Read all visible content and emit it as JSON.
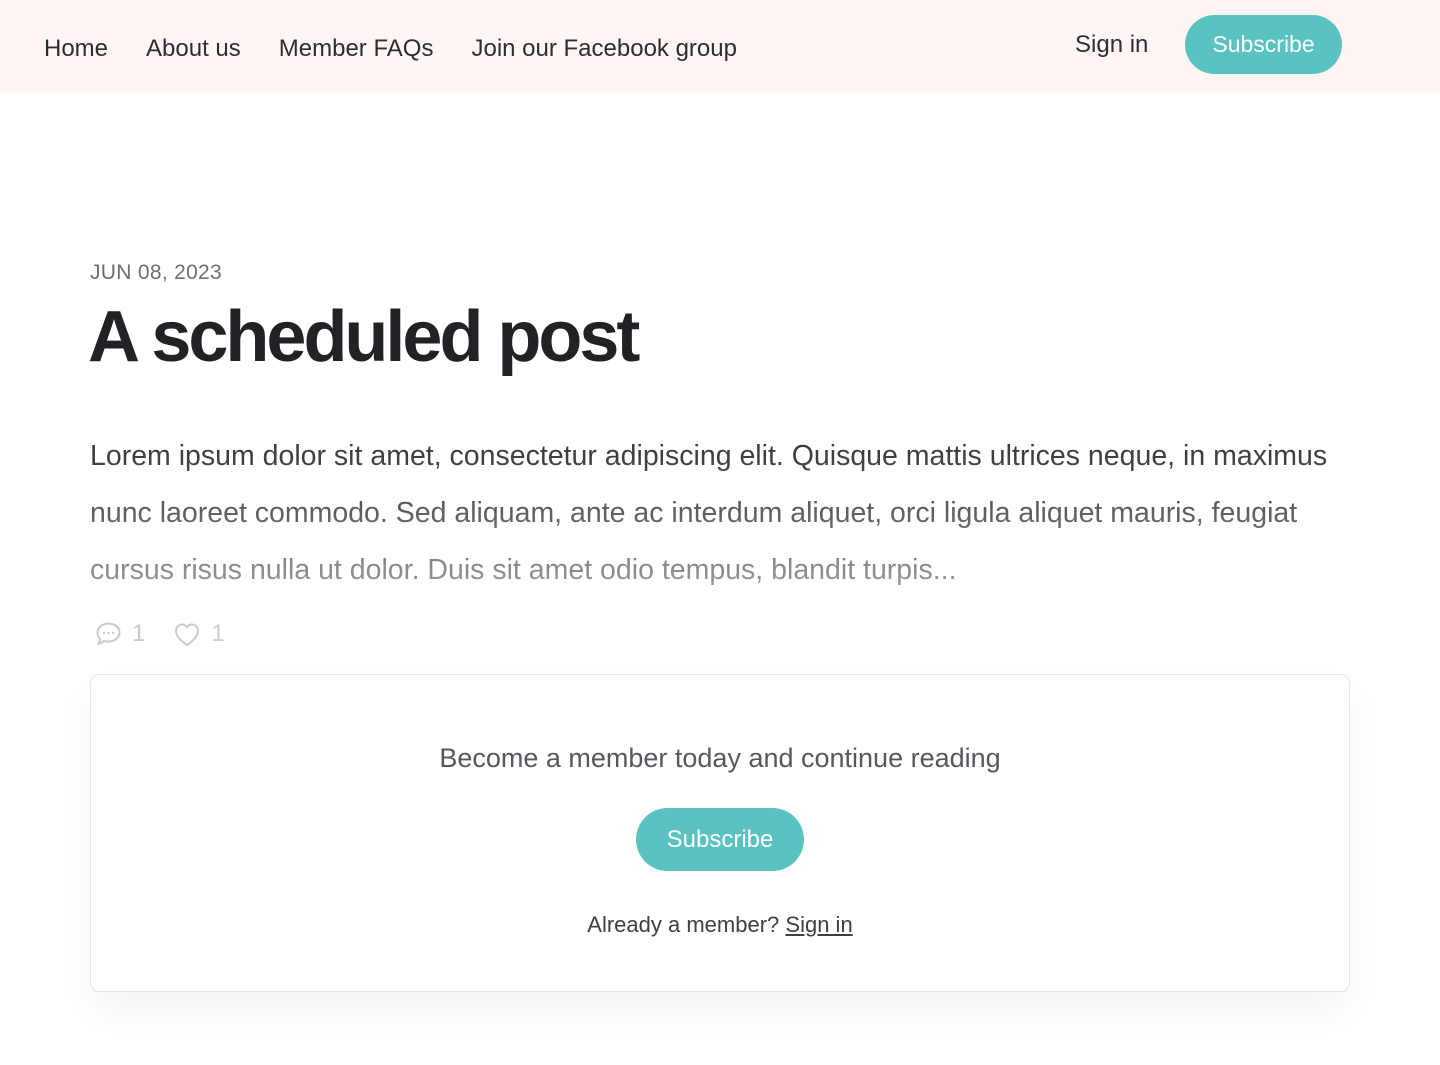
{
  "header": {
    "nav": [
      {
        "label": "Home"
      },
      {
        "label": "About us"
      },
      {
        "label": "Member FAQs"
      },
      {
        "label": "Join our Facebook group"
      }
    ],
    "sign_in_label": "Sign in",
    "subscribe_label": "Subscribe"
  },
  "post": {
    "date": "JUN 08, 2023",
    "title": "A scheduled post",
    "excerpt": "Lorem ipsum dolor sit amet, consectetur adipiscing elit. Quisque mattis ultrices neque, in maximus nunc laoreet commodo. Sed aliquam, ante ac interdum aliquet, orci ligula aliquet mauris, feugiat cursus risus nulla ut dolor. Duis sit amet odio tempus, blandit turpis...",
    "comment_count": "1",
    "like_count": "1"
  },
  "cta": {
    "heading": "Become a member today and continue reading",
    "subscribe_label": "Subscribe",
    "already_member_text": "Already a member?",
    "sign_in_label": "Sign in"
  },
  "icons": {
    "comment": "comment-icon",
    "like": "heart-icon"
  },
  "colors": {
    "accent": "#5ac3c2",
    "header_bg": "#fff5f5"
  }
}
